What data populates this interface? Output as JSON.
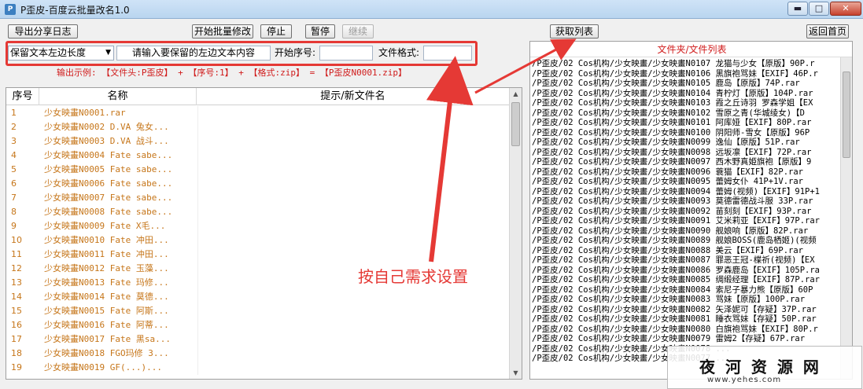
{
  "window": {
    "title": "P歪皮-百度云批量改名1.0",
    "icon": "app-icon",
    "controls": {
      "minimize": "▬",
      "maximize": "□",
      "close": "✕"
    }
  },
  "toolbar": {
    "export_log": "导出分享日志",
    "start_rename": "开始批量修改",
    "stop": "停止",
    "pause": "暂停",
    "resume": "继续",
    "fetch_list": "获取列表",
    "back_home": "返回首页"
  },
  "options": {
    "mode_selected": "保留文本左边长度",
    "keep_placeholder": "请输入要保留的左边文本内容",
    "serial_label": "开始序号:",
    "serial_value": "",
    "format_label": "文件格式:",
    "format_value": "",
    "example": "输出示例: 【文件头:P歪皮】 + 【序号:1】 + 【格式:zip】 = 【P歪皮N0001.zip】"
  },
  "table": {
    "columns": [
      "序号",
      "名称",
      "提示/新文件名"
    ],
    "rows": [
      {
        "no": "1",
        "name": "少女映畫N0001.rar"
      },
      {
        "no": "2",
        "name": "少女映畫N0002 D.VA 兔女..."
      },
      {
        "no": "3",
        "name": "少女映畫N0003 D.VA 战斗..."
      },
      {
        "no": "4",
        "name": "少女映畫N0004 Fate sabe..."
      },
      {
        "no": "5",
        "name": "少女映畫N0005 Fate sabe..."
      },
      {
        "no": "6",
        "name": "少女映畫N0006 Fate sabe..."
      },
      {
        "no": "7",
        "name": "少女映畫N0007 Fate sabe..."
      },
      {
        "no": "8",
        "name": "少女映畫N0008 Fate sabe..."
      },
      {
        "no": "9",
        "name": "少女映畫N0009 Fate X毛..."
      },
      {
        "no": "10",
        "name": "少女映畫N0010 Fate 冲田..."
      },
      {
        "no": "11",
        "name": "少女映畫N0011 Fate 冲田..."
      },
      {
        "no": "12",
        "name": "少女映畫N0012 Fate 玉藻..."
      },
      {
        "no": "13",
        "name": "少女映畫N0013 Fate 玛修..."
      },
      {
        "no": "14",
        "name": "少女映畫N0014 Fate 莫德..."
      },
      {
        "no": "15",
        "name": "少女映畫N0015 Fate 阿斯..."
      },
      {
        "no": "16",
        "name": "少女映畫N0016 Fate 阿蒂..."
      },
      {
        "no": "17",
        "name": "少女映畫N0017 Fate 黑sa..."
      },
      {
        "no": "18",
        "name": "少女映畫N0018 FGO玛修 3..."
      },
      {
        "no": "19",
        "name": "少女映畫N0019 GF(...)..."
      }
    ]
  },
  "file_list": {
    "title": "文件夹/文件列表",
    "items": [
      "/P歪皮/02 Cos机构/少女映畫/少女映畫N0107 龙猫与少女【原版】90P.r",
      "/P歪皮/02 Cos机构/少女映畫/少女映畫N0106 黑旗袍骂妹【EXIF】46P.r",
      "/P歪皮/02 Cos机构/少女映畫/少女映畫N0105 鹿岛【原版】74P.rar",
      "/P歪皮/02 Cos机构/少女映畫/少女映畫N0104 青柠灯【原版】104P.rar",
      "/P歪皮/02 Cos机构/少女映畫/少女映畫N0103 霞之丘诗羽 罗森学姐【EX",
      "/P歪皮/02 Cos机构/少女映畫/少女映畫N0102 雪原之青(华城绫女)【D",
      "/P歪皮/02 Cos机构/少女映畫/少女映畫N0101 阿库娅【EXIF】80P.rar",
      "/P歪皮/02 Cos机构/少女映畫/少女映畫N0100 阴阳师-雪女【原版】96P",
      "/P歪皮/02 Cos机构/少女映畫/少女映畫N0099 逸仙【原版】51P.rar",
      "/P歪皮/02 Cos机构/少女映畫/少女映畫N0098 远坂凛【EXIF】72P.rar",
      "/P歪皮/02 Cos机构/少女映畫/少女映畫N0097 西木野真姫旗袍【原版】9",
      "/P歪皮/02 Cos机构/少女映畫/少女映畫N0096 蓑猫【EXIF】82P.rar",
      "/P歪皮/02 Cos机构/少女映畫/少女映畫N0095 蕾姆女仆 41P+1V.rar",
      "/P歪皮/02 Cos机构/少女映畫/少女映畫N0094 蕾姆(视频)【EXIF】91P+1",
      "/P歪皮/02 Cos机构/少女映畫/少女映畫N0093 莫德雷德战斗服 33P.rar",
      "/P歪皮/02 Cos机构/少女映畫/少女映畫N0092 苗刻刻【EXIF】93P.rar",
      "/P歪皮/02 Cos机构/少女映畫/少女映畫N0091 艾米莉亚【EXIF】97P.rar",
      "/P歪皮/02 Cos机构/少女映畫/少女映畫N0090 舰娘响【原版】82P.rar",
      "/P歪皮/02 Cos机构/少女映畫/少女映畫N0089 舰娘BOSS(鹿岛栖姬)(视频",
      "/P歪皮/02 Cos机构/少女映畫/少女映畫N0088 美云【EXIF】69P.rar",
      "/P歪皮/02 Cos机构/少女映畫/少女映畫N0087 罪恶王冠-楪祈(视频)【EX",
      "/P歪皮/02 Cos机构/少女映畫/少女映畫N0086 罗森鹿岛【EXIF】105P.ra",
      "/P歪皮/02 Cos机构/少女映畫/少女映畫N0085 绸缎经理【EXIF】87P.rar",
      "/P歪皮/02 Cos机构/少女映畫/少女映畫N0084 索尼子暴力熊【原版】60P",
      "/P歪皮/02 Cos机构/少女映畫/少女映畫N0083 骂妹【原版】100P.rar",
      "/P歪皮/02 Cos机构/少女映畫/少女映畫N0082 矢泽妮可【存疑】37P.rar",
      "/P歪皮/02 Cos机构/少女映畫/少女映畫N0081 睡衣骂妹【存疑】50P.rar",
      "/P歪皮/02 Cos机构/少女映畫/少女映畫N0080 白旗袍骂妹【EXIF】80P.r",
      "/P歪皮/02 Cos机构/少女映畫/少女映畫N0079 雷姆2【存疑】67P.rar",
      "/P歪皮/02 Cos机构/少女映畫/少女映畫N0078 ...",
      "/P歪皮/02 Cos机构/少女映畫/少女映畫N0077 ..."
    ]
  },
  "annotation": {
    "note": "按自己需求设置",
    "color": "#e53935"
  },
  "watermark": {
    "title": "夜 河 资 源 网",
    "url": "www.yehes.com"
  },
  "colors": {
    "accent_red": "#d01b1b",
    "row_orange": "#c6761a"
  }
}
